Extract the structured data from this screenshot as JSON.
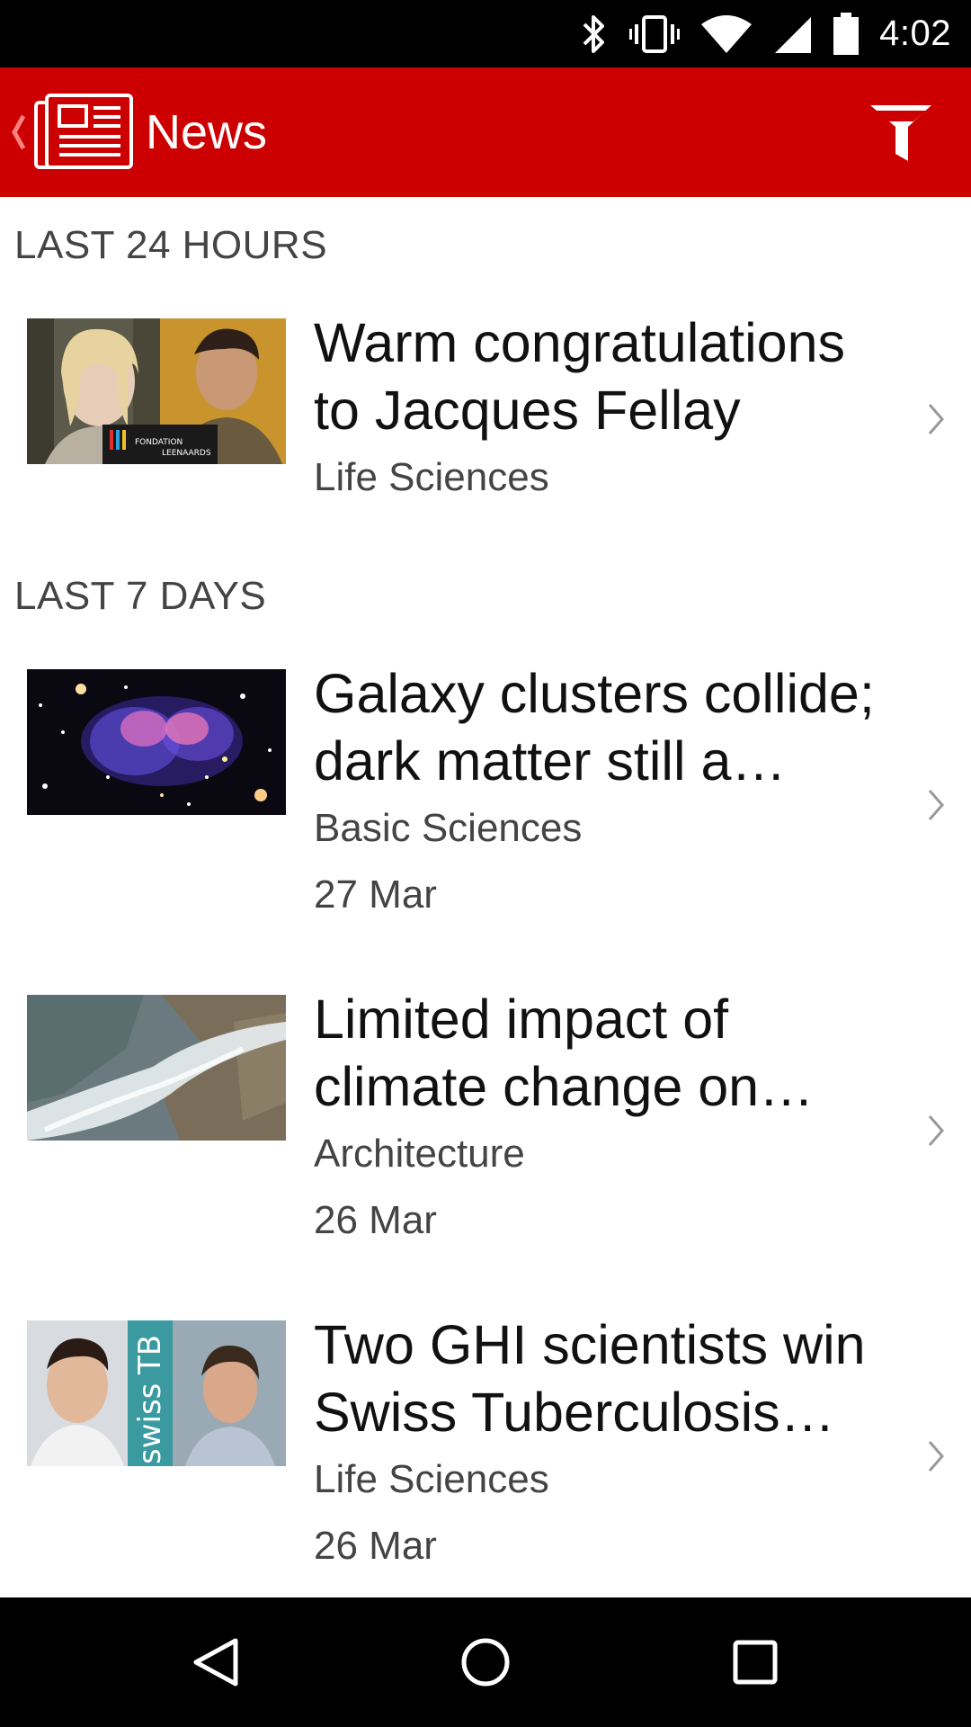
{
  "status_bar": {
    "time": "4:02",
    "icons": [
      "bluetooth-icon",
      "vibrate-icon",
      "wifi-icon",
      "cell-signal-icon",
      "battery-icon"
    ]
  },
  "app_bar": {
    "title": "News",
    "color": "#cc0000",
    "back_icon": "chevron-left-icon",
    "logo_icon": "newspaper-icon",
    "filter_icon": "filter-icon"
  },
  "sections": [
    {
      "header": "LAST 24 HOURS",
      "items": [
        {
          "title_line1": "Warm congratulations",
          "title_line2": "to Jacques Fellay",
          "category": "Life Sciences",
          "date": "",
          "thumb_text": [
            "FONDATION",
            "LEENAARDS"
          ]
        }
      ]
    },
    {
      "header": "LAST 7 DAYS",
      "items": [
        {
          "title_line1": "Galaxy clusters collide;",
          "title_line2": "dark matter still a…",
          "category": "Basic Sciences",
          "date": "27 Mar"
        },
        {
          "title_line1": "Limited impact of",
          "title_line2": "climate change on…",
          "category": "Architecture",
          "date": "26 Mar"
        },
        {
          "title_line1": "Two GHI scientists win",
          "title_line2": "Swiss Tuberculosis…",
          "category": "Life Sciences",
          "date": "26 Mar",
          "thumb_text": [
            "swiss",
            "TB"
          ]
        }
      ]
    }
  ],
  "nav_bar": {
    "buttons": [
      "back-icon",
      "home-icon",
      "recents-icon"
    ]
  }
}
